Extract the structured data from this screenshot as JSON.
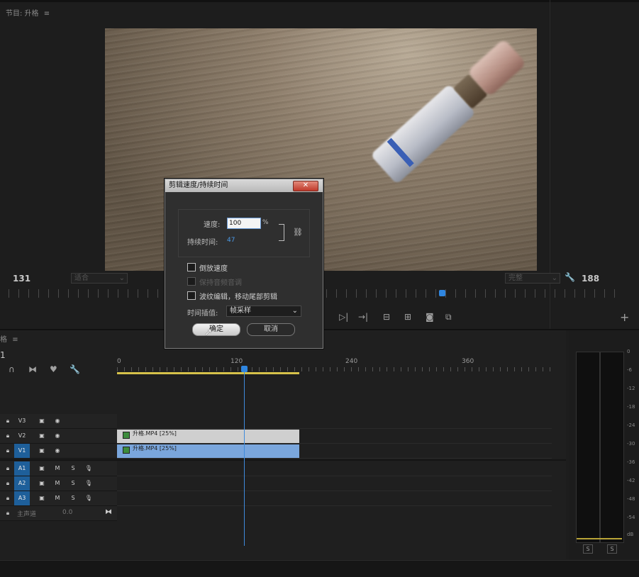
{
  "program_monitor": {
    "panel_title": "节目: 升格",
    "timecode_left": "131",
    "fit_dropdown": "适合",
    "quality_dropdown": "完整",
    "timecode_right": "188"
  },
  "timeline": {
    "panel_title": "格",
    "ruler_labels": [
      "0",
      "120",
      "240",
      "360"
    ],
    "video_tracks": [
      {
        "name": "V3",
        "clip": null
      },
      {
        "name": "V2",
        "clip": "升格.MP4 [25%]"
      },
      {
        "name": "V1",
        "clip": "升格.MP4 [25%]"
      }
    ],
    "audio_tracks": [
      {
        "name": "A1",
        "m": "M",
        "s": "S"
      },
      {
        "name": "A2",
        "m": "M",
        "s": "S"
      },
      {
        "name": "A3",
        "m": "M",
        "s": "S"
      }
    ],
    "master_label": "主声道",
    "master_value": "0.0",
    "playhead_frame": 131
  },
  "meters": {
    "scale": [
      "0",
      "-6",
      "-12",
      "-18",
      "-24",
      "-30",
      "-36",
      "-42",
      "-48",
      "-54",
      "dB"
    ],
    "solo_left": "S",
    "solo_right": "S"
  },
  "dialog": {
    "title": "剪辑速度/持续时间",
    "speed_label": "速度:",
    "speed_value": "100",
    "speed_unit": "%",
    "duration_label": "持续时间:",
    "duration_value": "47",
    "options": [
      {
        "label": "倒放速度",
        "checked": false,
        "disabled": false
      },
      {
        "label": "保持音频音调",
        "checked": false,
        "disabled": true
      },
      {
        "label": "波纹编辑，移动尾部剪辑",
        "checked": false,
        "disabled": false
      }
    ],
    "interp_label": "时间插值:",
    "interp_value": "帧采样",
    "ok_label": "确定",
    "cancel_label": "取消"
  }
}
